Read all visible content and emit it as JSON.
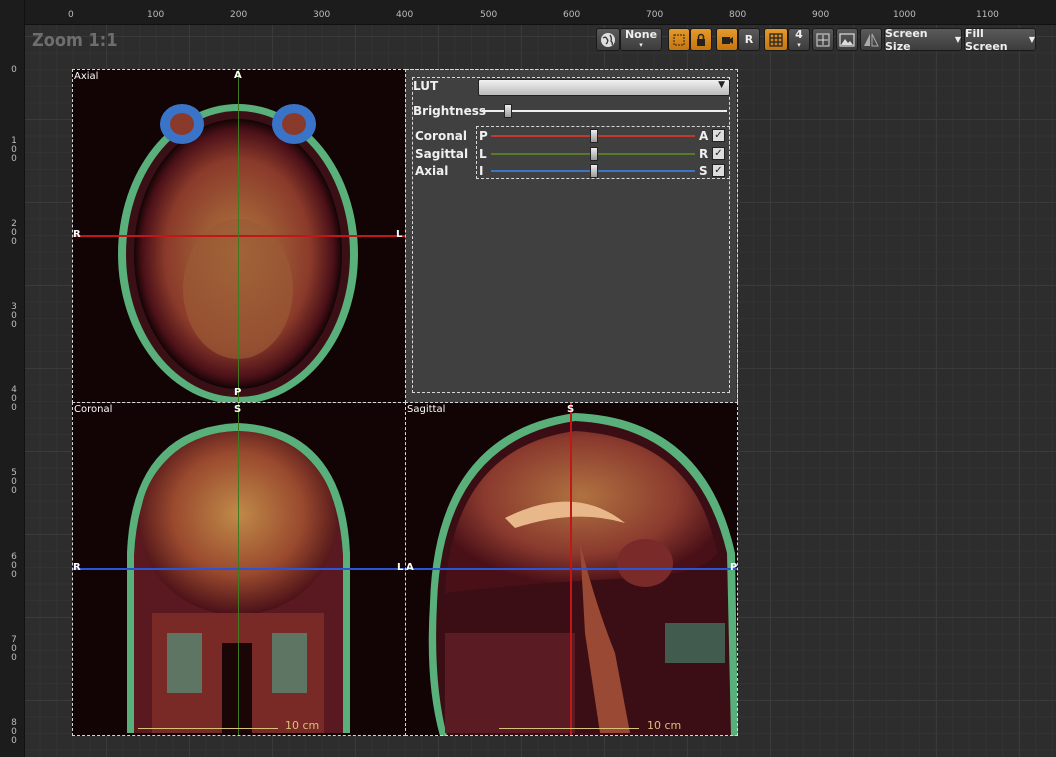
{
  "ruler": {
    "top_labels": [
      "0",
      "100",
      "200",
      "300",
      "400",
      "500",
      "600",
      "700",
      "800",
      "900",
      "1000",
      "1100"
    ],
    "left_labels": [
      "0",
      "1 0 0",
      "2 0 0",
      "3 0 0",
      "4 0 0",
      "5 0 0",
      "6 0 0",
      "7 0 0",
      "8 0 0"
    ]
  },
  "zoom_label": "Zoom 1:1",
  "toolbar": {
    "world_icon": "globe-icon",
    "none_label": "None",
    "r_label": "R",
    "grid_value": "4",
    "screen_size_label": "Screen Size",
    "fill_screen_label": "Fill Screen"
  },
  "views": {
    "axial": {
      "label": "Axial",
      "top": "A",
      "bottom": "P",
      "left": "R",
      "right": "L"
    },
    "coronal": {
      "label": "Coronal",
      "top": "S",
      "left": "R",
      "right": "L",
      "scale": "10 cm"
    },
    "sagittal": {
      "label": "Sagittal",
      "top": "S",
      "left": "A",
      "right": "P",
      "scale": "10 cm"
    }
  },
  "panel": {
    "lut_label": "LUT",
    "brightness_label": "Brightness",
    "brightness_value": 0.1,
    "rows": [
      {
        "label": "Coronal",
        "left": "P",
        "right": "A",
        "color": "#c0392b",
        "value": 0.5,
        "checked": "✓"
      },
      {
        "label": "Sagittal",
        "left": "L",
        "right": "R",
        "color": "#5a7a2a",
        "value": 0.5,
        "checked": "✓"
      },
      {
        "label": "Axial",
        "left": "I",
        "right": "S",
        "color": "#3d74c4",
        "value": 0.5,
        "checked": "✓"
      }
    ]
  },
  "colors": {
    "red_line": "#c01818",
    "green_line": "#3f7a1f",
    "blue_line": "#2a55d4",
    "accent": "#e08a20"
  }
}
